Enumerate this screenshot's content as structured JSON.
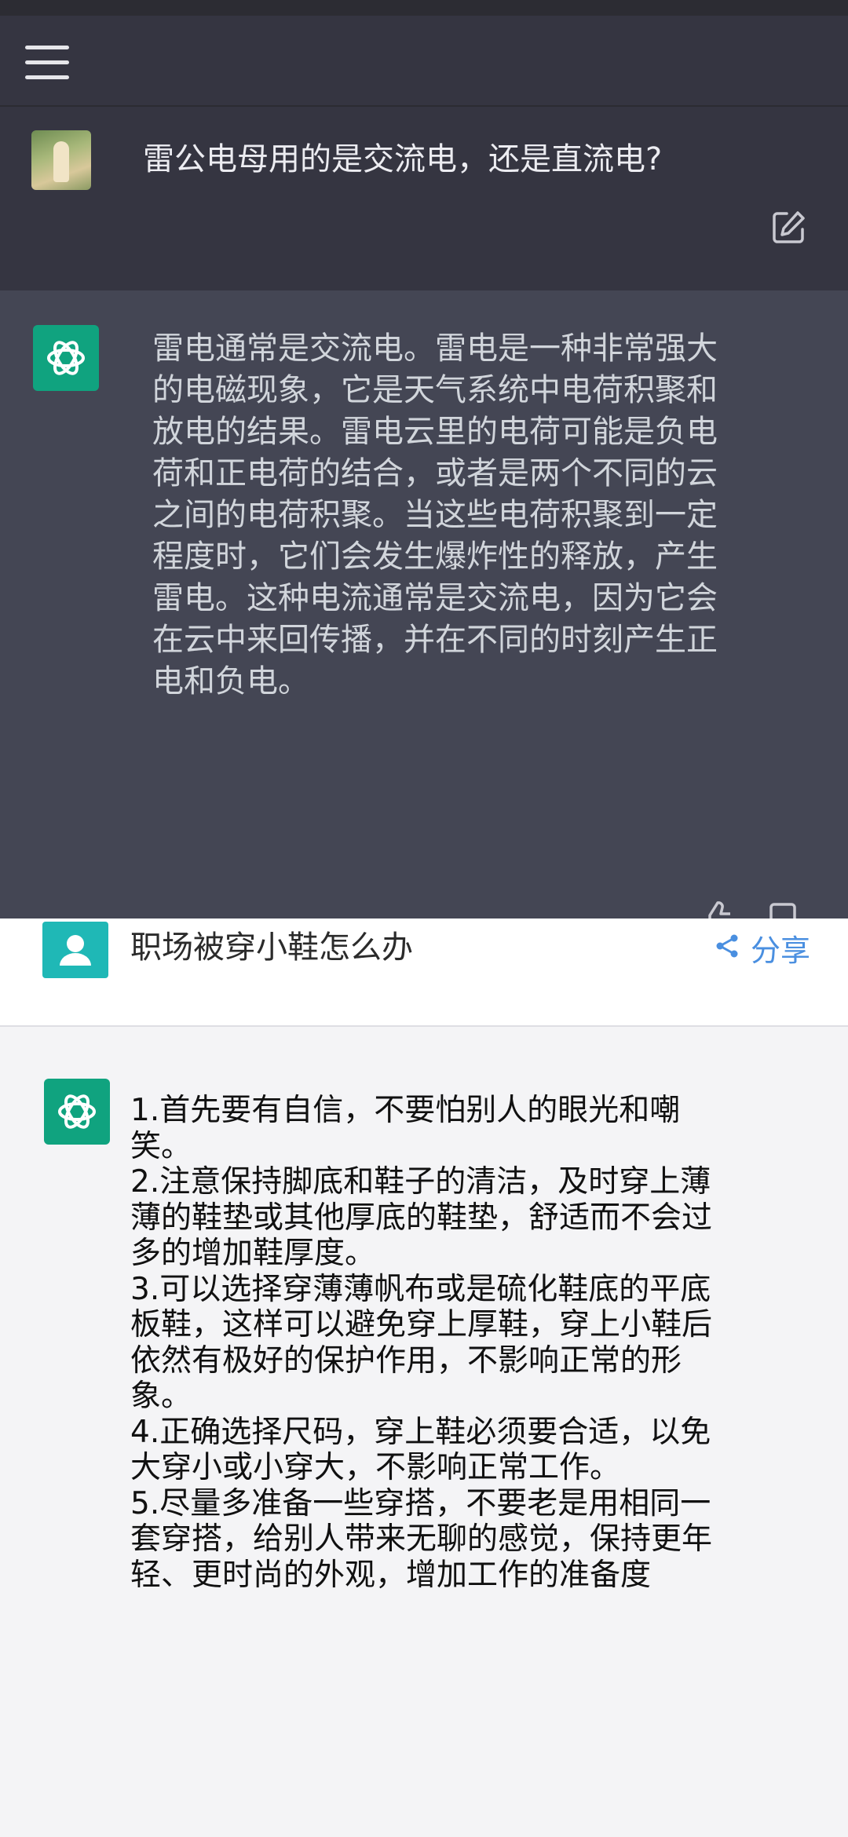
{
  "top_chat": {
    "question": "雷公电母用的是交流电，还是直流电?",
    "answer_lines": [
      "雷电通常是交流电。雷电是一种非常强大",
      "的电磁现象，它是天气系统中电荷积聚和",
      "放电的结果。雷电云里的电荷可能是负电",
      "荷和正电荷的结合，或者是两个不同的云",
      "之间的电荷积聚。当这些电荷积聚到一定",
      "程度时，它们会发生爆炸性的释放，产生",
      "雷电。这种电流通常是交流电，因为它会",
      "在云中来回传播，并在不同的时刻产生正",
      "电和负电。"
    ]
  },
  "bottom_chat": {
    "question": "职场被穿小鞋怎么办",
    "share_label": "分享",
    "answer_lines": [
      "1.首先要有自信，不要怕别人的眼光和嘲",
      "笑。",
      "2.注意保持脚底和鞋子的清洁，及时穿上薄",
      "薄的鞋垫或其他厚底的鞋垫，舒适而不会过",
      "多的增加鞋厚度。",
      "3.可以选择穿薄薄帆布或是硫化鞋底的平底",
      "板鞋，这样可以避免穿上厚鞋，穿上小鞋后",
      "依然有极好的保护作用，不影响正常的形",
      "象。",
      "4.正确选择尺码，穿上鞋必须要合适，以免",
      "大穿小或小穿大，不影响正常工作。",
      "5.尽量多准备一些穿搭，不要老是用相同一",
      "套穿搭，给别人带来无聊的感觉，保持更年",
      "轻、更时尚的外观，增加工作的准备度"
    ]
  },
  "icons": {
    "menu": "hamburger-menu-icon",
    "edit": "edit-icon",
    "assistant": "openai-logo-icon",
    "user": "user-avatar-icon",
    "share": "share-icon"
  },
  "colors": {
    "dark_bg": "#353541",
    "dark_answer_bg": "#444654",
    "light_bg": "#f4f4f6",
    "brand_green": "#10a37f",
    "share_blue": "#4a8fe0",
    "user_teal": "#1fb8b6"
  }
}
